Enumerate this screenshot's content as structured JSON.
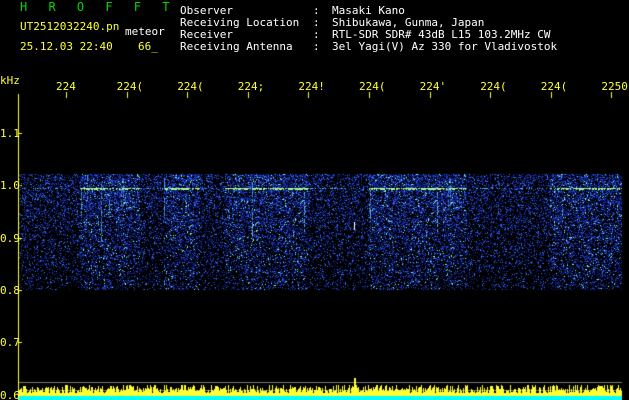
{
  "app": {
    "title": "H R O F F T",
    "filename": "UT2512032240.pn",
    "mode": "meteor",
    "datetime": "25.12.03 22:40",
    "count": "66_"
  },
  "header": {
    "rows": [
      {
        "key": "Observer",
        "value": "Masaki Kano"
      },
      {
        "key": "Receiving Location",
        "value": "Shibukawa, Gunma, Japan"
      },
      {
        "key": "Receiver",
        "value": "RTL-SDR SDR# 43dB L15 103.2MHz CW"
      },
      {
        "key": "Receiving Antenna",
        "value": "3el Yagi(V) Az 330 for Vladivostok"
      }
    ]
  },
  "colors": {
    "title": "#00d800",
    "axis": "#ffff33",
    "signal_low": "#1a2fd0",
    "signal_high": "#66ffee",
    "noise_bar": "#ffff33",
    "baseline": "#00ffff"
  },
  "chart_data": {
    "type": "heatmap",
    "y_unit_label": "kHz",
    "y_ticks": [
      {
        "label": "1.1",
        "value": 1.1
      },
      {
        "label": "1.0",
        "value": 1.0
      },
      {
        "label": "0.9",
        "value": 0.9
      },
      {
        "label": "0.8",
        "value": 0.8
      },
      {
        "label": "0.7",
        "value": 0.7
      },
      {
        "label": "0.6",
        "value": 0.6
      }
    ],
    "x_tick_labels": [
      "224",
      "224(",
      "224(",
      "224;",
      "224!",
      "224(",
      "224'",
      "224(",
      "224(",
      "2250"
    ],
    "ylim": [
      0.59,
      1.17
    ],
    "signal_band": [
      0.8,
      1.02
    ],
    "echo_line": 0.995,
    "bright_intervals_fraction": [
      [
        0.1,
        0.2
      ],
      [
        0.24,
        0.3
      ],
      [
        0.34,
        0.48
      ],
      [
        0.58,
        0.74
      ],
      [
        0.88,
        1.0
      ]
    ],
    "meteor_spike_fraction": 0.556
  }
}
